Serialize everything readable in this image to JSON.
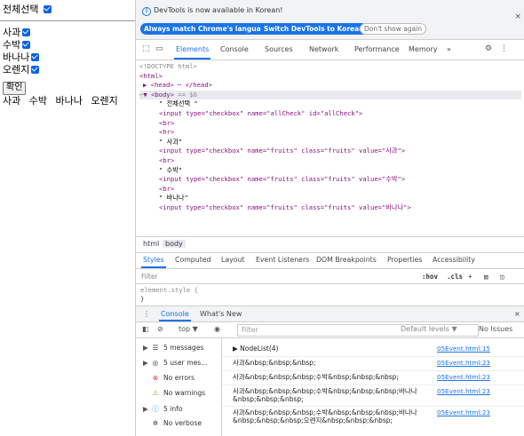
{
  "page": {
    "select_all_label": "전체선택",
    "fruits": [
      "사과",
      "수박",
      "바나나",
      "오렌지"
    ],
    "confirm_button": "확인",
    "output_text": "사과 수박 바나나 오렌지"
  },
  "devtools": {
    "info_message": "DevTools is now available in Korean!",
    "btn_match_language": "Always match Chrome's language",
    "btn_switch_korean": "Switch DevTools to Korean",
    "btn_dont_show": "Don't show again",
    "tabs": [
      "Elements",
      "Console",
      "Sources",
      "Network",
      "Performance",
      "Memory"
    ],
    "more_tabs": "»",
    "code": {
      "doctype": "<!DOCTYPE html>",
      "html_open": "<html>",
      "head": "<head> ⋯ </head>",
      "body_open": "<body>",
      "body_marker": "== $0",
      "select_all_text": "\" 전체선택 \"",
      "input_all": "<input type=\"checkbox\" name=\"allCheck\" id=\"allCheck\">",
      "br": "<br>",
      "hr": "<hr>",
      "fruit1_text": "\" 사과\"",
      "fruit1_input": "<input type=\"checkbox\" name=\"fruits\" class=\"fruits\" value=\"사과\">",
      "fruit2_text": "\" 수박\"",
      "fruit2_input": "<input type=\"checkbox\" name=\"fruits\" class=\"fruits\" value=\"수박\">",
      "fruit3_text": "\" 바나나\"",
      "fruit3_input": "<input type=\"checkbox\" name=\"fruits\" class=\"fruits\" value=\"바나나\">"
    },
    "breadcrumbs": [
      "html",
      "body"
    ],
    "styles_tabs": [
      "Styles",
      "Computed",
      "Layout",
      "Event Listeners",
      "DOM Breakpoints",
      "Properties",
      "Accessibility"
    ],
    "filter_placeholder": "Filter",
    "hov_label": ":hov",
    "cls_label": ".cls",
    "element_style_1": "element.style {",
    "element_style_2": "}",
    "drawer_tabs": [
      "Console",
      "What's New"
    ],
    "console_context": "top ▼",
    "console_filter_placeholder": "Filter",
    "default_levels": "Default levels ▼",
    "no_issues": "No Issues",
    "sidebar": [
      {
        "label": "5 messages",
        "icon": "list-icon"
      },
      {
        "label": "5 user mes...",
        "icon": "user-icon"
      },
      {
        "label": "No errors",
        "icon": "error-icon"
      },
      {
        "label": "No warnings",
        "icon": "warning-icon"
      },
      {
        "label": "5 info",
        "icon": "info-icon"
      },
      {
        "label": "No verbose",
        "icon": "bug-icon"
      }
    ],
    "logs": [
      {
        "text": "▶ NodeList(4)",
        "link": "05Event.html:15"
      },
      {
        "text": "사과&nbsp;&nbsp;&nbsp;",
        "link": "05Event.html:23"
      },
      {
        "text": "사과&nbsp;&nbsp;&nbsp;수박&nbsp;&nbsp;&nbsp;",
        "link": "05Event.html:23"
      },
      {
        "text": "사과&nbsp;&nbsp;&nbsp;수박&nbsp;&nbsp;&nbsp;바나나",
        "text2": "&nbsp;&nbsp;&nbsp;",
        "link": "05Event.html:23"
      },
      {
        "text": "사과&nbsp;&nbsp;&nbsp;수박&nbsp;&nbsp;&nbsp;바나나",
        "text2": "&nbsp;&nbsp;&nbsp;오렌지&nbsp;&nbsp;&nbsp;",
        "link": "05Event.html:23"
      }
    ],
    "colors": {
      "accent": "#1a73e8",
      "tag": "#881280",
      "attr": "#994500",
      "value": "#1a1aa6"
    }
  }
}
